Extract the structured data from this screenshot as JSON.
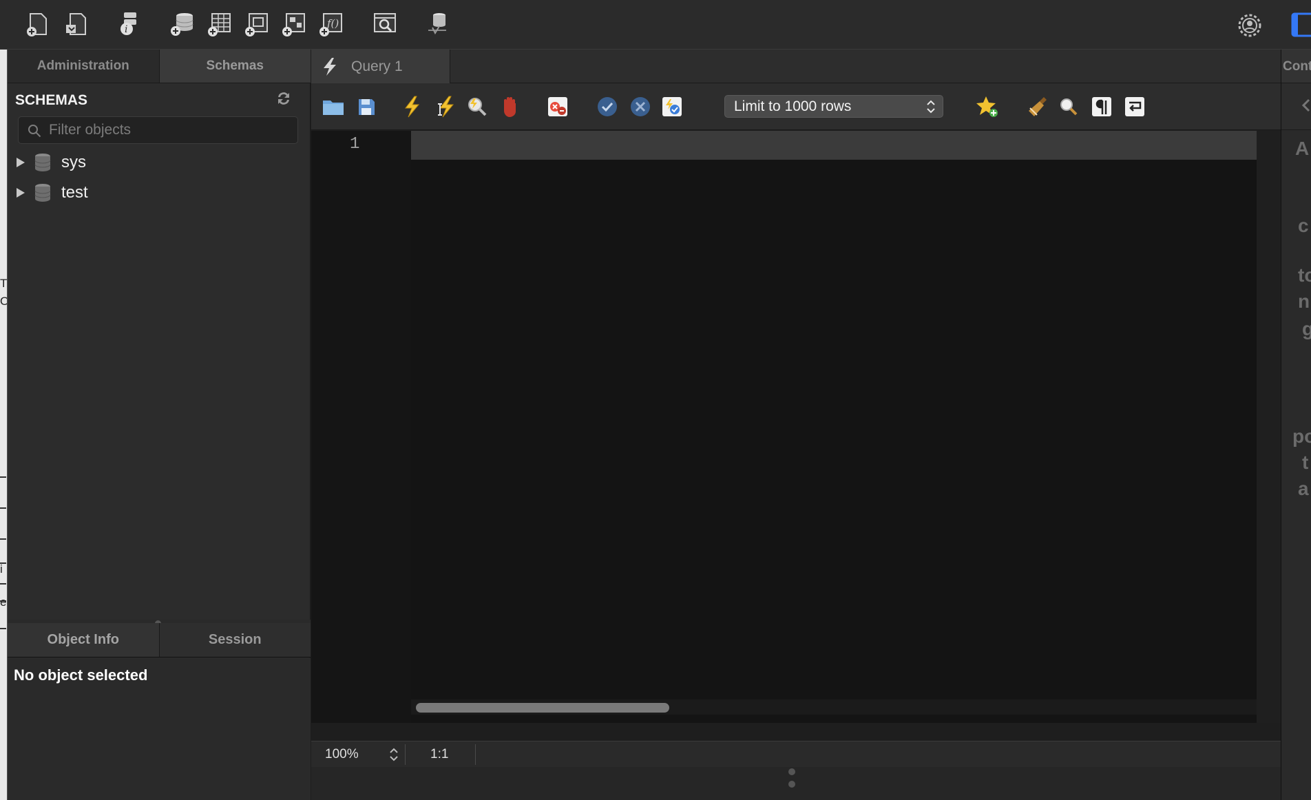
{
  "toolbar": {
    "icons": [
      "new-sql-tab-icon",
      "open-sql-script-icon",
      "server-info-icon",
      "create-schema-icon",
      "create-table-icon",
      "create-view-icon",
      "create-procedure-icon",
      "create-function-icon",
      "search-table-data-icon",
      "reconnect-icon"
    ],
    "right_icons": [
      "settings-gear-icon",
      "toggle-panel-icon"
    ]
  },
  "sidebar": {
    "tabs": [
      "Administration",
      "Schemas"
    ],
    "active_tab": "Schemas",
    "header": "SCHEMAS",
    "filter_placeholder": "Filter objects",
    "schemas": [
      {
        "label": "sys"
      },
      {
        "label": "test"
      }
    ],
    "bottom_tabs": [
      "Object Info",
      "Session"
    ],
    "info_text": "No object selected"
  },
  "editor": {
    "tab_label": "Query 1",
    "limit_label": "Limit to 1000 rows",
    "line_numbers": [
      "1"
    ],
    "zoom": "100%",
    "position": "1:1"
  },
  "right_panel": {
    "header": "Cont",
    "fragments": [
      "A",
      "c",
      "to",
      "n",
      "g",
      "po",
      "t",
      "a"
    ]
  },
  "left_strip": {
    "fragments": [
      "T",
      "O",
      "i",
      "e"
    ]
  },
  "colors": {
    "background": "#1e1e1e",
    "editor_background": "#141414",
    "current_line": "#3b3b3b",
    "accent_blue": "#3478f6"
  }
}
